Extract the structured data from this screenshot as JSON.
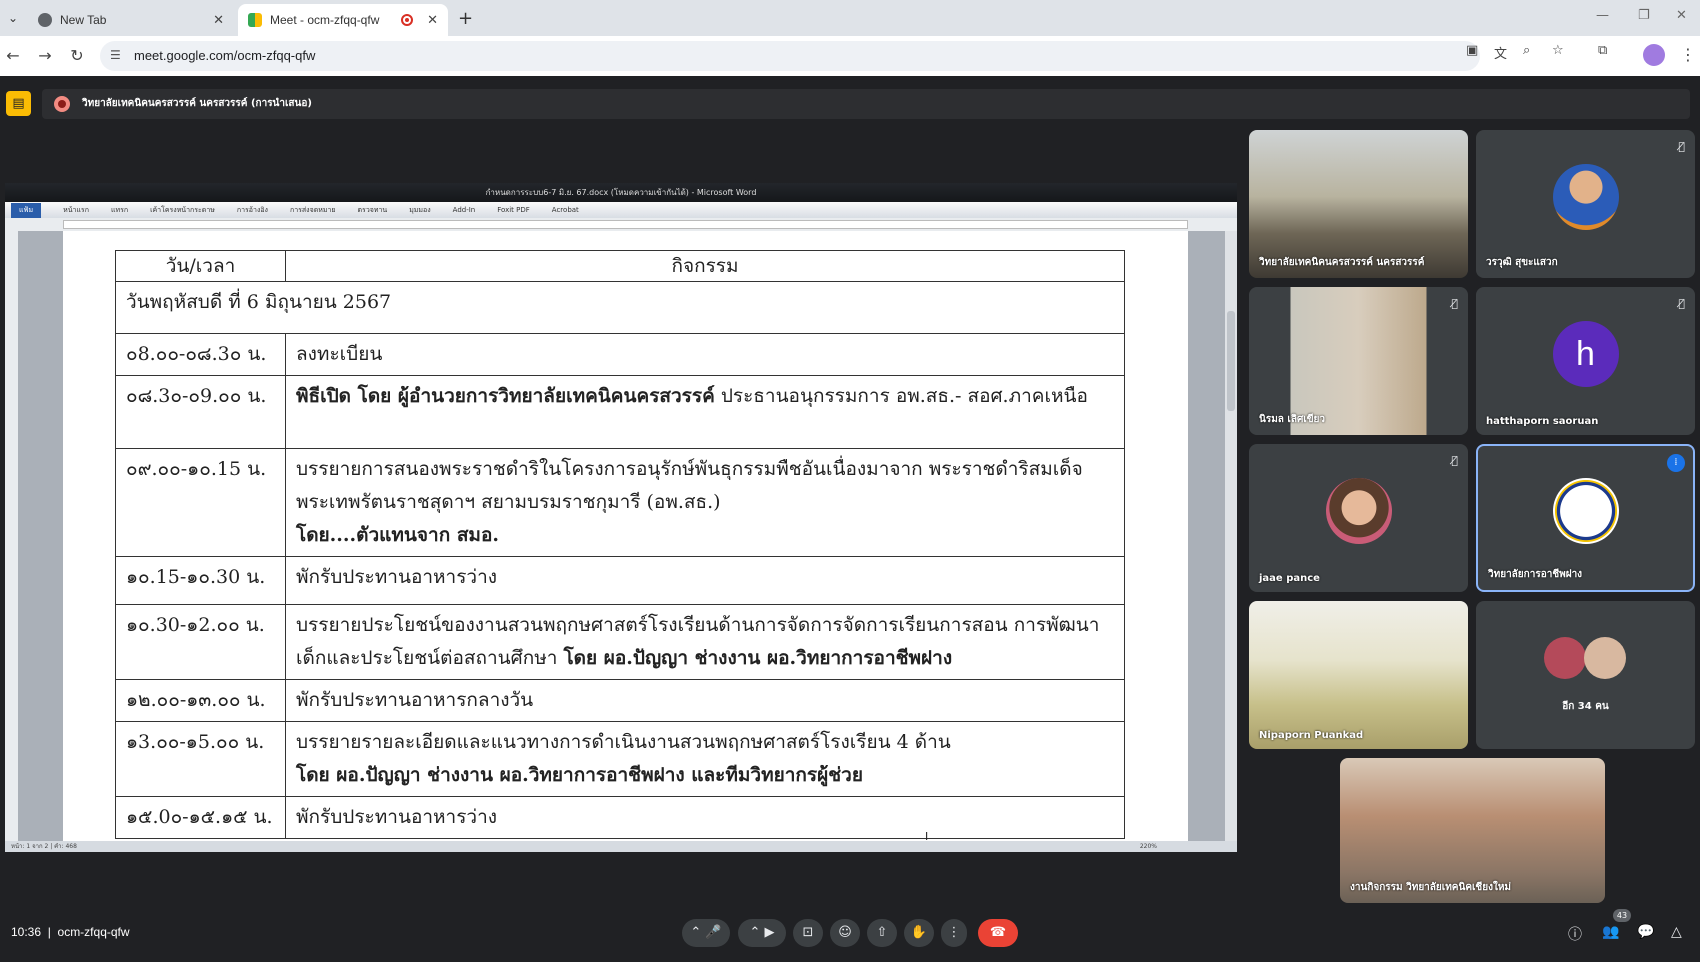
{
  "browser": {
    "tabs": [
      {
        "title": "New Tab",
        "active": false
      },
      {
        "title": "Meet - ocm-zfqq-qfw",
        "active": true
      }
    ],
    "url": "meet.google.com/ocm-zfqq-qfw"
  },
  "presentation": {
    "label": "วิทยาลัยเทคนิคนครสวรรค์ นครสวรรค์ (การนำเสนอ)"
  },
  "word": {
    "title": "กำหนดการระบบ6-7 มิ.ย. 67.docx (โหมดความเข้ากันได้) - Microsoft Word",
    "ribbon": [
      "แฟ้ม",
      "หน้าแรก",
      "แทรก",
      "เค้าโครงหน้ากระดาษ",
      "การอ้างอิง",
      "การส่งจดหมาย",
      "ตรวจทาน",
      "มุมมอง",
      "Add-In",
      "Foxit PDF",
      "Acrobat"
    ],
    "status_left": "หน้า: 1 จาก 2  |  คำ: 468",
    "zoom": "220%"
  },
  "schedule": {
    "header": {
      "time": "วัน/เวลา",
      "activity": "กิจกรรม"
    },
    "day": "วันพฤหัสบดี ที่ 6 มิถุนายน 2567",
    "rows": [
      {
        "time": "๐8.๐๐-๐๘.3๐ น.",
        "activity": "ลงทะเบียน",
        "bold_prefix": ""
      },
      {
        "time": "๐๘.3๐-๐9.๐๐ น.",
        "bold_prefix": "พิธีเปิด โดย ผู้อำนวยการวิทยาลัยเทคนิคนครสวรรค์",
        "activity": " ประธานอนุกรรมการ อพ.สธ.- สอศ.ภาคเหนือ"
      },
      {
        "time": "๐๙.๐๐-๑๐.15 น.",
        "activity": "บรรยายการสนองพระราชดำริในโครงการอนุรักษ์พันธุกรรมพืชอันเนื่องมาจาก พระราชดำริสมเด็จพระเทพรัตนราชสุดาฯ สยามบรมราชกุมารี (อพ.สธ.)",
        "bold_suffix": "โดย....ตัวแทนจาก สมอ.",
        "bold_prefix": ""
      },
      {
        "time": "๑๐.15-๑๐.30 น.",
        "activity": "พักรับประทานอาหารว่าง",
        "bold_prefix": ""
      },
      {
        "time": "๑๐.30-๑2.๐๐ น.",
        "activity": "บรรยายประโยชน์ของงานสวนพฤกษศาสตร์โรงเรียนด้านการจัดการจัดการเรียนการสอน การพัฒนาเด็กและประโยชน์ต่อสถานศึกษา ",
        "bold_suffix": "โดย ผอ.ปัญญา  ช่างงาน ผอ.วิทยาการอาชีพฝาง",
        "bold_prefix": ""
      },
      {
        "time": "๑๒.๐๐-๑๓.๐๐ น.",
        "activity": "พักรับประทานอาหารกลางวัน",
        "bold_prefix": ""
      },
      {
        "time": "๑3.๐๐-๑5.๐๐ น.",
        "activity": "บรรยายรายละเอียดและแนวทางการดำเนินงานสวนพฤกษศาสตร์โรงเรียน 4 ด้าน",
        "bold_suffix": "โดย  ผอ.ปัญญา  ช่างงาน ผอ.วิทยาการอาชีพฝาง และทีมวิทยากรผู้ช่วย",
        "bold_prefix": ""
      },
      {
        "time": "๑๕.0๐-๑๕.๑๕ น.",
        "activity": "พักรับประทานอาหารว่าง",
        "bold_prefix": ""
      }
    ]
  },
  "participants": [
    {
      "name": "วิทยาลัยเทคนิคนครสวรรค์ นครสวรรค์",
      "muted": false,
      "type": "video"
    },
    {
      "name": "วรวุฒิ สุขะแสวก",
      "muted": true,
      "type": "avatar"
    },
    {
      "name": "นิรมล เลิศเขียว",
      "muted": true,
      "type": "video"
    },
    {
      "name": "hatthaporn saoruan",
      "muted": true,
      "type": "initial",
      "initial": "h",
      "color": "#5b2bbb"
    },
    {
      "name": "jaae pance",
      "muted": true,
      "type": "avatar"
    },
    {
      "name": "วิทยาลัยการอาชีพฝาง",
      "muted": false,
      "type": "logo",
      "speaking": true
    },
    {
      "name": "Nipaporn Puankad",
      "muted": false,
      "type": "video"
    },
    {
      "name": "อีก 34 คน",
      "muted": false,
      "type": "more"
    }
  ],
  "self_view": {
    "name": "งานกิจกรรม วิทยาลัยเทคนิคเชียงใหม่"
  },
  "footer": {
    "time": "10:36",
    "meeting_code": "ocm-zfqq-qfw",
    "participant_count": "43"
  },
  "colors": {
    "accent": "#8ab4f8",
    "end_call": "#ea4335",
    "meet_bg": "#202124"
  }
}
